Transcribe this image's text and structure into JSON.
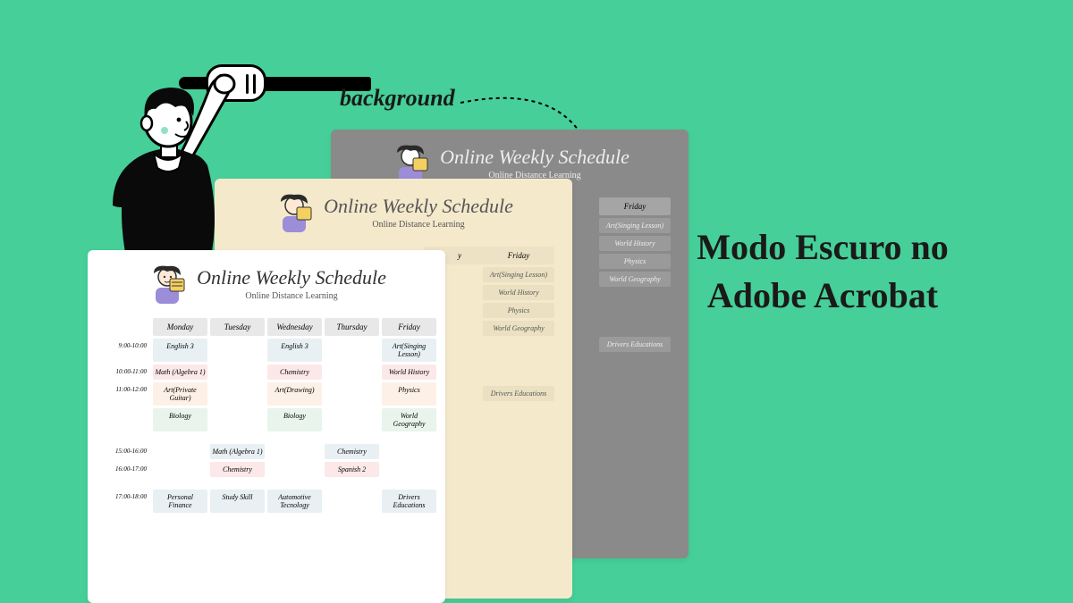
{
  "headline": "Modo Escuro no Adobe Acrobat",
  "annotation": "background",
  "card": {
    "title": "Online Weekly Schedule",
    "subtitle": "Online Distance Learning"
  },
  "days": {
    "mon": "Monday",
    "tue": "Tuesday",
    "wed": "Wednesday",
    "thu": "Thursday",
    "fri": "Friday"
  },
  "times": {
    "r1": "9:00-10:00",
    "r2": "10:00-11:00",
    "r3": "11:00-12:00",
    "r4": "",
    "r5": "15:00-16:00",
    "r6": "16:00-17:00",
    "r7": "17:00-18:00"
  },
  "subjects": {
    "english3": "English 3",
    "mathAlg": "Math (Algebra 1)",
    "artGuitar": "Art(Private Guitar)",
    "biology": "Biology",
    "chemistry": "Chemistry",
    "artDrawing": "Art(Drawing)",
    "artSinging": "Art(Singing Lesson)",
    "worldHistory": "World History",
    "physics": "Physics",
    "worldGeo": "World Geography",
    "spanish2": "Spanish 2",
    "personalFinance": "Personal Finance",
    "studySkill": "Study Skill",
    "autoTech": "Automotive Tecnology",
    "driversEd": "Drivers Educations"
  }
}
